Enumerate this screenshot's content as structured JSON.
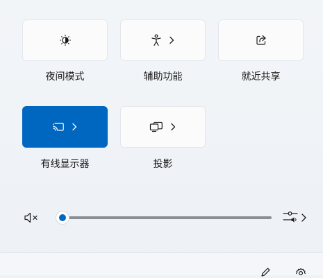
{
  "quick_settings": {
    "tiles": [
      {
        "label": "夜间模式",
        "icon": "brightness-moon-icon",
        "has_submenu": false,
        "active": false
      },
      {
        "label": "辅助功能",
        "icon": "accessibility-icon",
        "has_submenu": true,
        "active": false
      },
      {
        "label": "就近共享",
        "icon": "share-icon",
        "has_submenu": false,
        "active": false
      },
      {
        "label": "有线显示器",
        "icon": "cast-icon",
        "has_submenu": true,
        "active": true
      },
      {
        "label": "投影",
        "icon": "project-icon",
        "has_submenu": true,
        "active": false
      }
    ]
  },
  "volume": {
    "icon": "volume-muted-icon",
    "level": 0,
    "output_icon": "audio-output-icon"
  },
  "footer": {
    "edit_icon": "edit-icon",
    "settings_icon": "settings-icon"
  },
  "colors": {
    "accent": "#0067c0",
    "tile_bg": "#fbfbfc",
    "panel_bg": "#eef2f6"
  }
}
